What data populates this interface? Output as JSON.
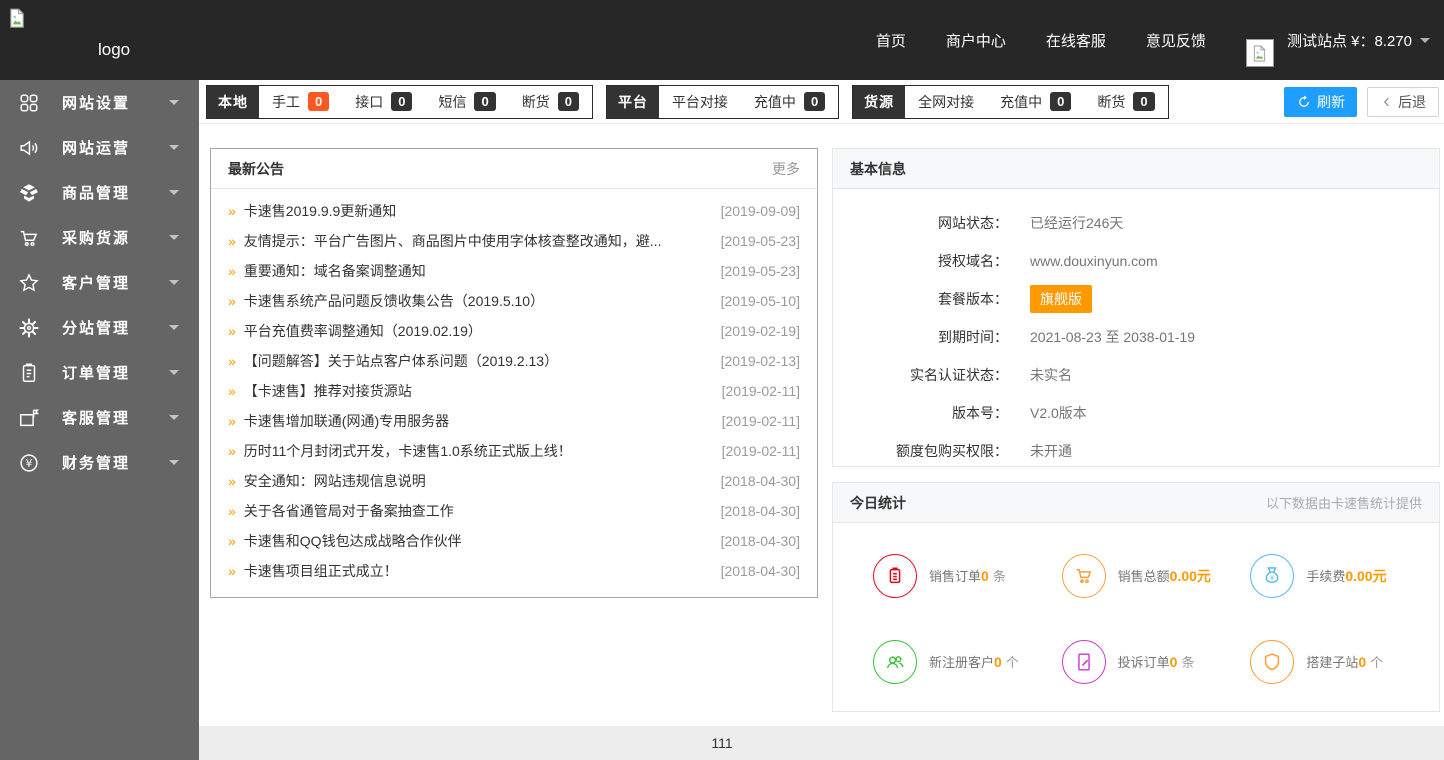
{
  "header": {
    "logo_text": "logo",
    "nav": [
      "首页",
      "商户中心",
      "在线客服",
      "意见反馈"
    ],
    "site_label": "测试站点 ¥：8.270"
  },
  "toolbar": {
    "groups": [
      {
        "tab": "本地",
        "items": [
          {
            "label": "手工",
            "count": "0",
            "highlight": true
          },
          {
            "label": "接口",
            "count": "0"
          },
          {
            "label": "短信",
            "count": "0"
          },
          {
            "label": "断货",
            "count": "0"
          }
        ]
      },
      {
        "tab": "平台",
        "items": [
          {
            "label": "平台对接"
          },
          {
            "label": "充值中",
            "count": "0"
          }
        ]
      },
      {
        "tab": "货源",
        "items": [
          {
            "label": "全网对接"
          },
          {
            "label": "充值中",
            "count": "0"
          },
          {
            "label": "断货",
            "count": "0"
          }
        ]
      }
    ],
    "refresh_label": "刷新",
    "back_label": "后退"
  },
  "sidebar": {
    "items": [
      {
        "label": "网站设置",
        "icon": "grid-icon"
      },
      {
        "label": "网站运营",
        "icon": "megaphone-icon"
      },
      {
        "label": "商品管理",
        "icon": "box-icon"
      },
      {
        "label": "采购货源",
        "icon": "cart-icon"
      },
      {
        "label": "客户管理",
        "icon": "star-icon"
      },
      {
        "label": "分站管理",
        "icon": "gear-icon"
      },
      {
        "label": "订单管理",
        "icon": "clipboard-icon"
      },
      {
        "label": "客服管理",
        "icon": "folder-flag-icon"
      },
      {
        "label": "财务管理",
        "icon": "yen-circle-icon"
      }
    ]
  },
  "announcements": {
    "title": "最新公告",
    "more_label": "更多",
    "marker": "»",
    "items": [
      {
        "text": "卡速售2019.9.9更新通知",
        "date": "[2019-09-09]"
      },
      {
        "text": "友情提示：平台广告图片、商品图片中使用字体核查整改通知，避...",
        "date": "[2019-05-23]"
      },
      {
        "text": "重要通知：域名备案调整通知",
        "date": "[2019-05-23]"
      },
      {
        "text": "卡速售系统产品问题反馈收集公告（2019.5.10）",
        "date": "[2019-05-10]"
      },
      {
        "text": "平台充值费率调整通知（2019.02.19）",
        "date": "[2019-02-19]"
      },
      {
        "text": "【问题解答】关于站点客户体系问题（2019.2.13）",
        "date": "[2019-02-13]"
      },
      {
        "text": "【卡速售】推荐对接货源站",
        "date": "[2019-02-11]"
      },
      {
        "text": "卡速售增加联通(网通)专用服务器",
        "date": "[2019-02-11]"
      },
      {
        "text": "历时11个月封闭式开发，卡速售1.0系统正式版上线！",
        "date": "[2019-02-11]"
      },
      {
        "text": "安全通知：网站违规信息说明",
        "date": "[2018-04-30]"
      },
      {
        "text": "关于各省通管局对于备案抽查工作",
        "date": "[2018-04-30]"
      },
      {
        "text": "卡速售和QQ钱包达成战略合作伙伴",
        "date": "[2018-04-30]"
      },
      {
        "text": "卡速售项目组正式成立！",
        "date": "[2018-04-30]"
      }
    ]
  },
  "basic_info": {
    "title": "基本信息",
    "rows": [
      {
        "label": "网站状态：",
        "value": "已经运行246天"
      },
      {
        "label": "授权域名：",
        "value": "www.douxinyun.com"
      },
      {
        "label": "套餐版本：",
        "value": "旗舰版",
        "type": "badge"
      },
      {
        "label": "到期时间：",
        "value": "2021-08-23 至 2038-01-19"
      },
      {
        "label": "实名认证状态：",
        "value": "未实名"
      },
      {
        "label": "版本号：",
        "value": "V2.0版本"
      },
      {
        "label": "额度包购买权限：",
        "value": "未开通"
      }
    ]
  },
  "today_stats": {
    "title": "今日统计",
    "note": "以下数据由卡速售统计提供",
    "items": [
      {
        "label": "销售订单",
        "value": "0",
        "unit": "条",
        "color": "#e60012",
        "icon": "order-icon"
      },
      {
        "label": "销售总额",
        "value": "0.00元",
        "unit": "",
        "color": "#ff9c38",
        "icon": "cart-icon"
      },
      {
        "label": "手续费",
        "value": "0.00元",
        "unit": "",
        "color": "#4db8f0",
        "icon": "money-bag-icon"
      },
      {
        "label": "新注册客户",
        "value": "0",
        "unit": "个",
        "color": "#2fc42f",
        "icon": "users-icon"
      },
      {
        "label": "投诉订单",
        "value": "0",
        "unit": "条",
        "color": "#cc33cc",
        "icon": "complaint-icon"
      },
      {
        "label": "搭建子站",
        "value": "0",
        "unit": "个",
        "color": "#ff9933",
        "icon": "shield-icon"
      }
    ]
  },
  "footer": {
    "text": "111"
  },
  "colors": {
    "accent_blue": "#1e9fff",
    "orange": "#ff9900",
    "badge_dark": "#333333",
    "badge_hot": "#ff5722",
    "header_bg": "#272727",
    "sidebar_bg": "#656565",
    "footer_bg": "#ededed"
  }
}
